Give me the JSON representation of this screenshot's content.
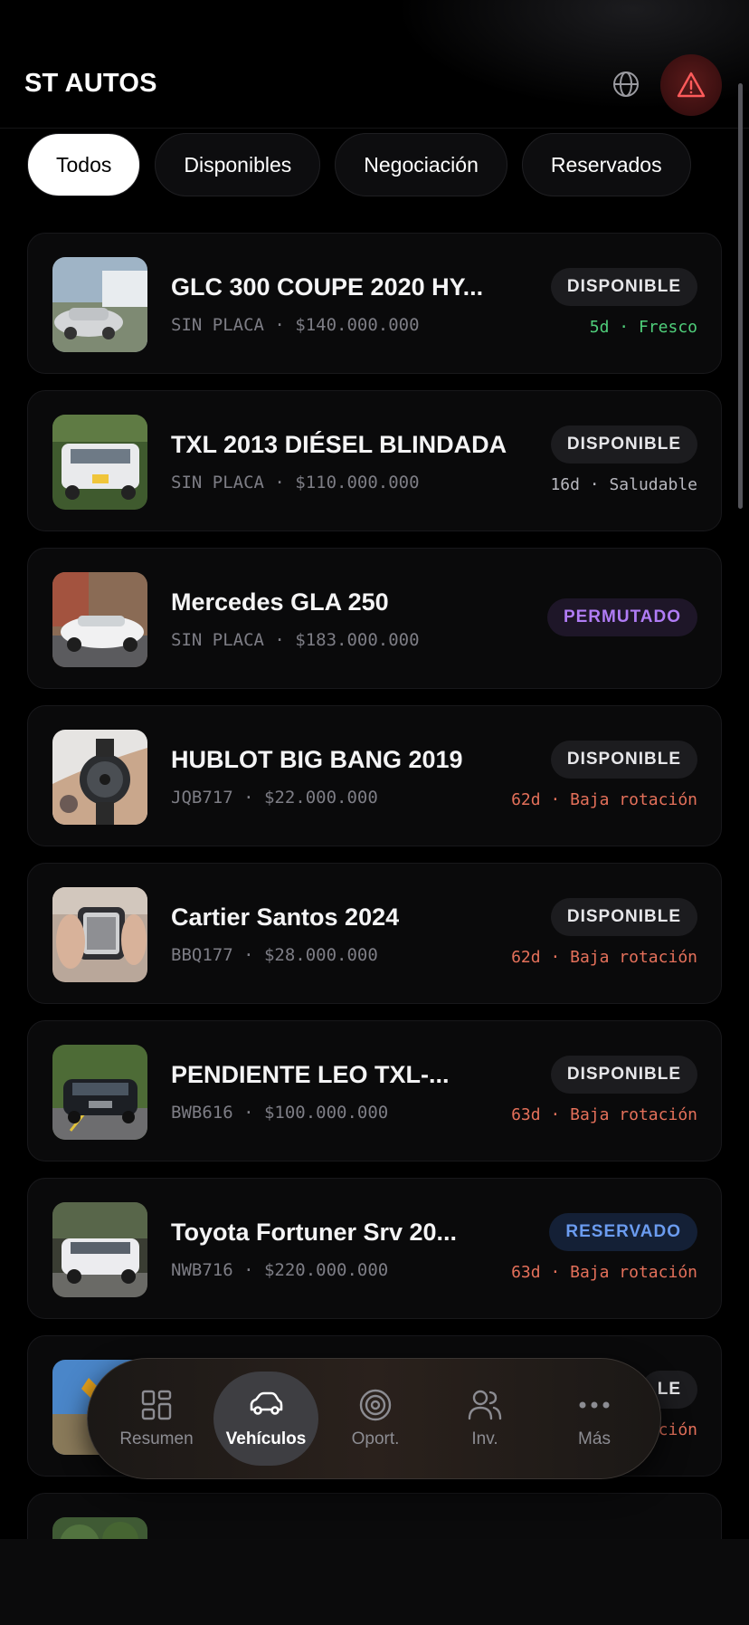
{
  "app": {
    "title": "ST AUTOS"
  },
  "header": {
    "globe_icon": "globe-icon",
    "alert_icon": "warning-triangle-icon"
  },
  "filters": [
    {
      "label": "Todos",
      "active": true
    },
    {
      "label": "Disponibles",
      "active": false
    },
    {
      "label": "Negociación",
      "active": false
    },
    {
      "label": "Reservados",
      "active": false
    }
  ],
  "vehicles": [
    {
      "title": "GLC 300 COUPE 2020 HY...",
      "plate": "SIN PLACA",
      "price": "$140.000.000",
      "sub": "SIN PLACA · $140.000.000",
      "status": "DISPONIBLE",
      "age": "5d · Fresco",
      "age_level": "fresh"
    },
    {
      "title": "TXL 2013 DIÉSEL BLINDADA",
      "plate": "SIN PLACA",
      "price": "$110.000.000",
      "sub": "SIN PLACA · $110.000.000",
      "status": "DISPONIBLE",
      "age": "16d · Saludable",
      "age_level": "ok"
    },
    {
      "title": "Mercedes GLA 250",
      "plate": "SIN PLACA",
      "price": "$183.000.000",
      "sub": "SIN PLACA · $183.000.000",
      "status": "PERMUTADO",
      "age": "",
      "age_level": ""
    },
    {
      "title": "HUBLOT BIG BANG 2019",
      "plate": "JQB717",
      "price": "$22.000.000",
      "sub": "JQB717 · $22.000.000",
      "status": "DISPONIBLE",
      "age": "62d · Baja rotación",
      "age_level": "low"
    },
    {
      "title": "Cartier Santos 2024",
      "plate": "BBQ177",
      "price": "$28.000.000",
      "sub": "BBQ177 · $28.000.000",
      "status": "DISPONIBLE",
      "age": "62d · Baja rotación",
      "age_level": "low"
    },
    {
      "title": "PENDIENTE LEO TXL-...",
      "plate": "BWB616",
      "price": "$100.000.000",
      "sub": "BWB616 · $100.000.000",
      "status": "DISPONIBLE",
      "age": "63d · Baja rotación",
      "age_level": "low"
    },
    {
      "title": "Toyota Fortuner Srv 20...",
      "plate": "NWB716",
      "price": "$220.000.000",
      "sub": "NWB716 · $220.000.000",
      "status": "RESERVADO",
      "age": "63d · Baja rotación",
      "age_level": "low"
    },
    {
      "title": "",
      "plate": "",
      "price": "",
      "sub": "",
      "status": "LE",
      "age": "ción",
      "age_level": "low"
    }
  ],
  "tabbar": [
    {
      "label": "Resumen",
      "icon": "grid-icon",
      "active": false
    },
    {
      "label": "Vehículos",
      "icon": "car-icon",
      "active": true
    },
    {
      "label": "Oport.",
      "icon": "target-icon",
      "active": false
    },
    {
      "label": "Inv.",
      "icon": "users-icon",
      "active": false
    },
    {
      "label": "Más",
      "icon": "more-dots-icon",
      "active": false
    }
  ],
  "colors": {
    "fresh": "#4fce7a",
    "ok": "#b8b8bf",
    "low": "#e4705a",
    "permutado": "#b07cf5",
    "reservado": "#6b9cf0"
  }
}
